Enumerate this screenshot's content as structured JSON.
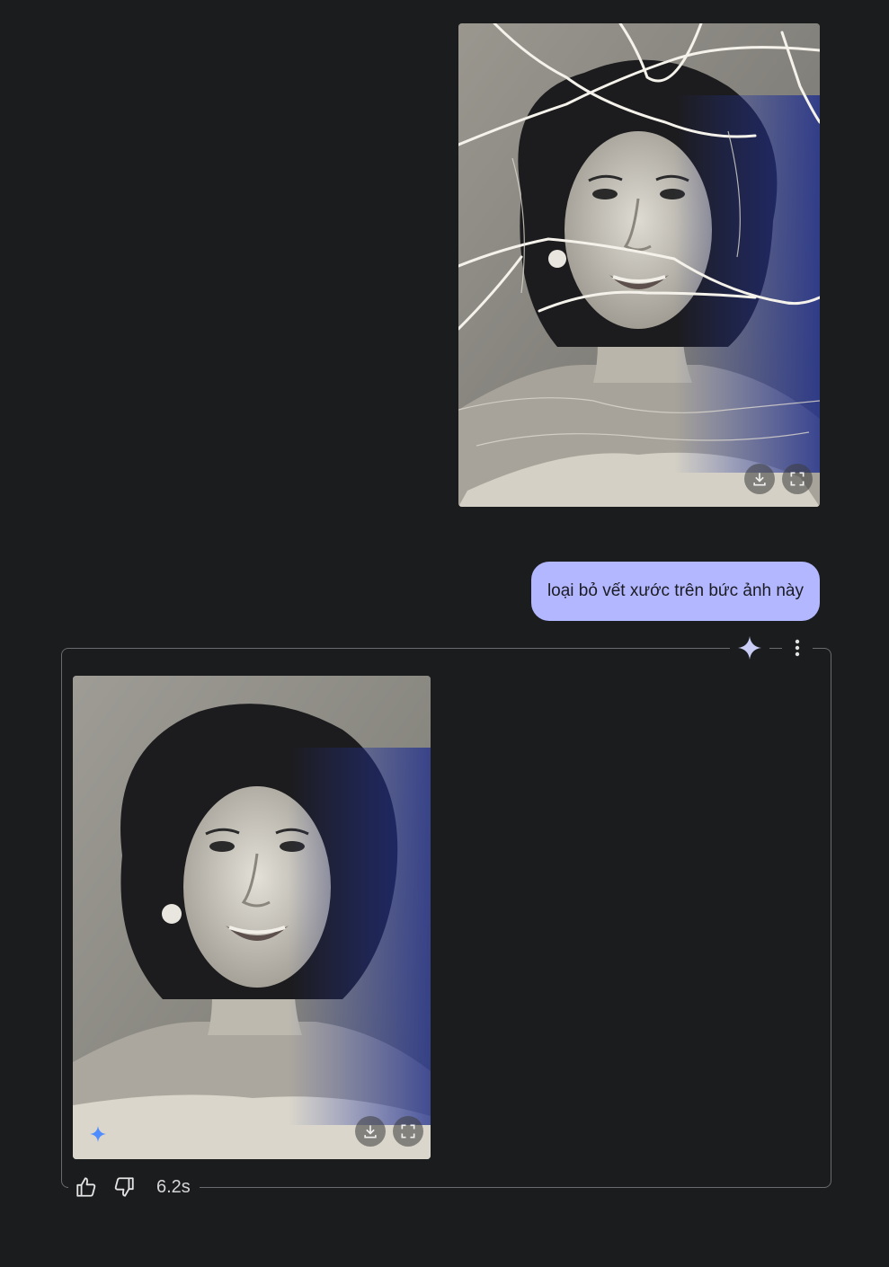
{
  "user_message": {
    "text": "loại bỏ vết xước trên bức ảnh này",
    "image_alt": "scratched-portrait"
  },
  "response": {
    "image_alt": "restored-portrait",
    "timing": "6.2s"
  },
  "icons": {
    "download": "download-icon",
    "fullscreen": "fullscreen-icon",
    "spark": "gemini-spark-icon",
    "more": "more-vert-icon",
    "thumbs_up": "thumbs-up-icon",
    "thumbs_down": "thumbs-down-icon"
  },
  "colors": {
    "background": "#1b1c1e",
    "user_bubble": "#b3b7ff",
    "frame_border": "#6a6b6e",
    "spark": "#c9cdf5",
    "badge": "#4f8cff"
  }
}
